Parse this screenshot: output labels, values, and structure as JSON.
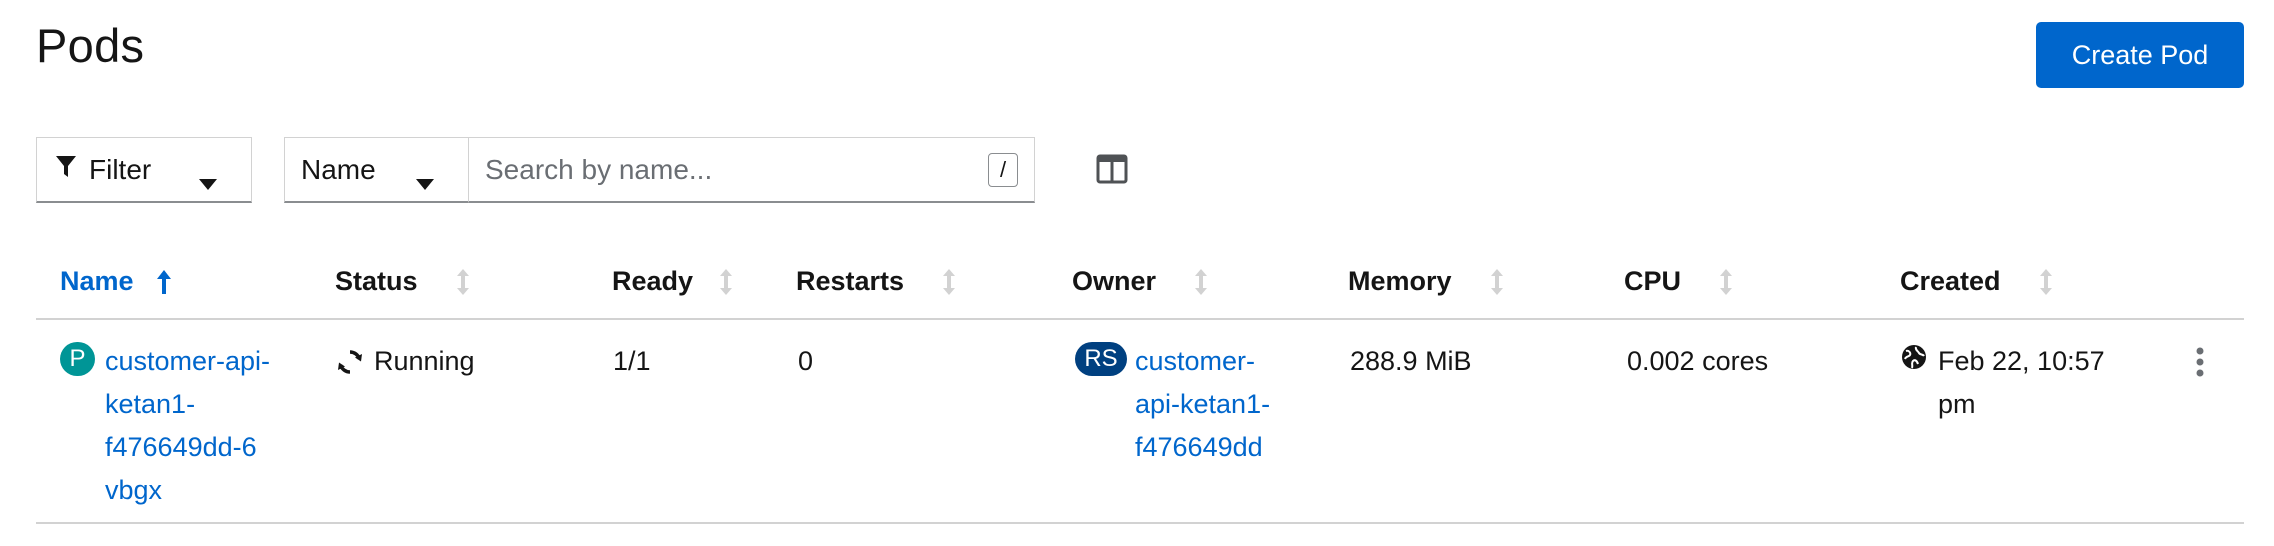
{
  "page": {
    "title": "Pods"
  },
  "header": {
    "create_label": "Create Pod"
  },
  "toolbar": {
    "filter_label": "Filter",
    "search_by": "Name",
    "search_placeholder": "Search by name...",
    "search_value": "",
    "shortcut_key": "/"
  },
  "table": {
    "columns": [
      "Name",
      "Status",
      "Ready",
      "Restarts",
      "Owner",
      "Memory",
      "CPU",
      "Created"
    ],
    "sorted_column": "Name",
    "sort_direction": "ascending",
    "rows": [
      {
        "kind_badge": "P",
        "name": "customer-api-ketan1-f476649dd-6vbgx",
        "name_lines": [
          "customer-api-",
          "ketan1-",
          "f476649dd-6",
          "vbgx"
        ],
        "status": "Running",
        "ready": "1/1",
        "restarts": "0",
        "owner_badge": "RS",
        "owner": "customer-api-ketan1-f476649dd",
        "owner_lines": [
          "customer-",
          "api-ketan1-",
          "f476649dd"
        ],
        "memory": "288.9 MiB",
        "cpu": "0.002 cores",
        "created": "Feb 22, 10:57 pm",
        "created_lines": [
          "Feb 22, 10:57",
          "pm"
        ]
      }
    ]
  },
  "icons": {
    "filter": "filter-icon",
    "caret": "caret-down-icon",
    "columns": "columns-icon",
    "sort_asc": "sort-ascending-icon",
    "sort": "sort-icon",
    "status": "sync-icon",
    "created": "globe-icon",
    "row_actions": "kebab-icon"
  },
  "colors": {
    "primary": "#0066cc",
    "pod_badge": "#009596",
    "replicaset_badge": "#004080",
    "border": "#d2d2d2"
  }
}
